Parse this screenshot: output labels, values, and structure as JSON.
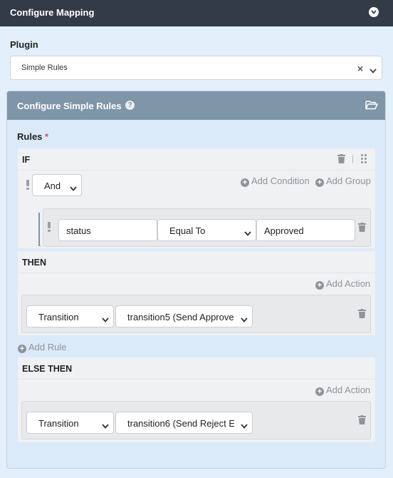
{
  "header": {
    "title": "Configure Mapping",
    "icon": "chevron-down-circle-icon"
  },
  "plugin": {
    "label": "Plugin",
    "selected": "Simple Rules"
  },
  "panel": {
    "title": "Configure Simple Rules",
    "help_icon": "question-circle-icon",
    "folder_icon": "folder-open-icon"
  },
  "rules": {
    "label": "Rules",
    "required_mark": "*",
    "if": {
      "label": "IF",
      "operator": "And",
      "add_condition": "Add Condition",
      "add_group": "Add Group",
      "condition": {
        "field": "status",
        "comparator": "Equal To",
        "value": "Approved"
      }
    },
    "then": {
      "label": "THEN",
      "add_action": "Add Action",
      "action": {
        "type": "Transition",
        "target": "transition5 (Send Approve"
      }
    },
    "add_rule": "Add Rule",
    "else_then": {
      "label": "ELSE THEN",
      "add_action": "Add Action",
      "action": {
        "type": "Transition",
        "target": "transition6 (Send Reject E"
      }
    }
  },
  "colors": {
    "topbar": "#333c46",
    "panel_header": "#7f95a8",
    "background": "#e3effb",
    "required": "#d9534f"
  }
}
